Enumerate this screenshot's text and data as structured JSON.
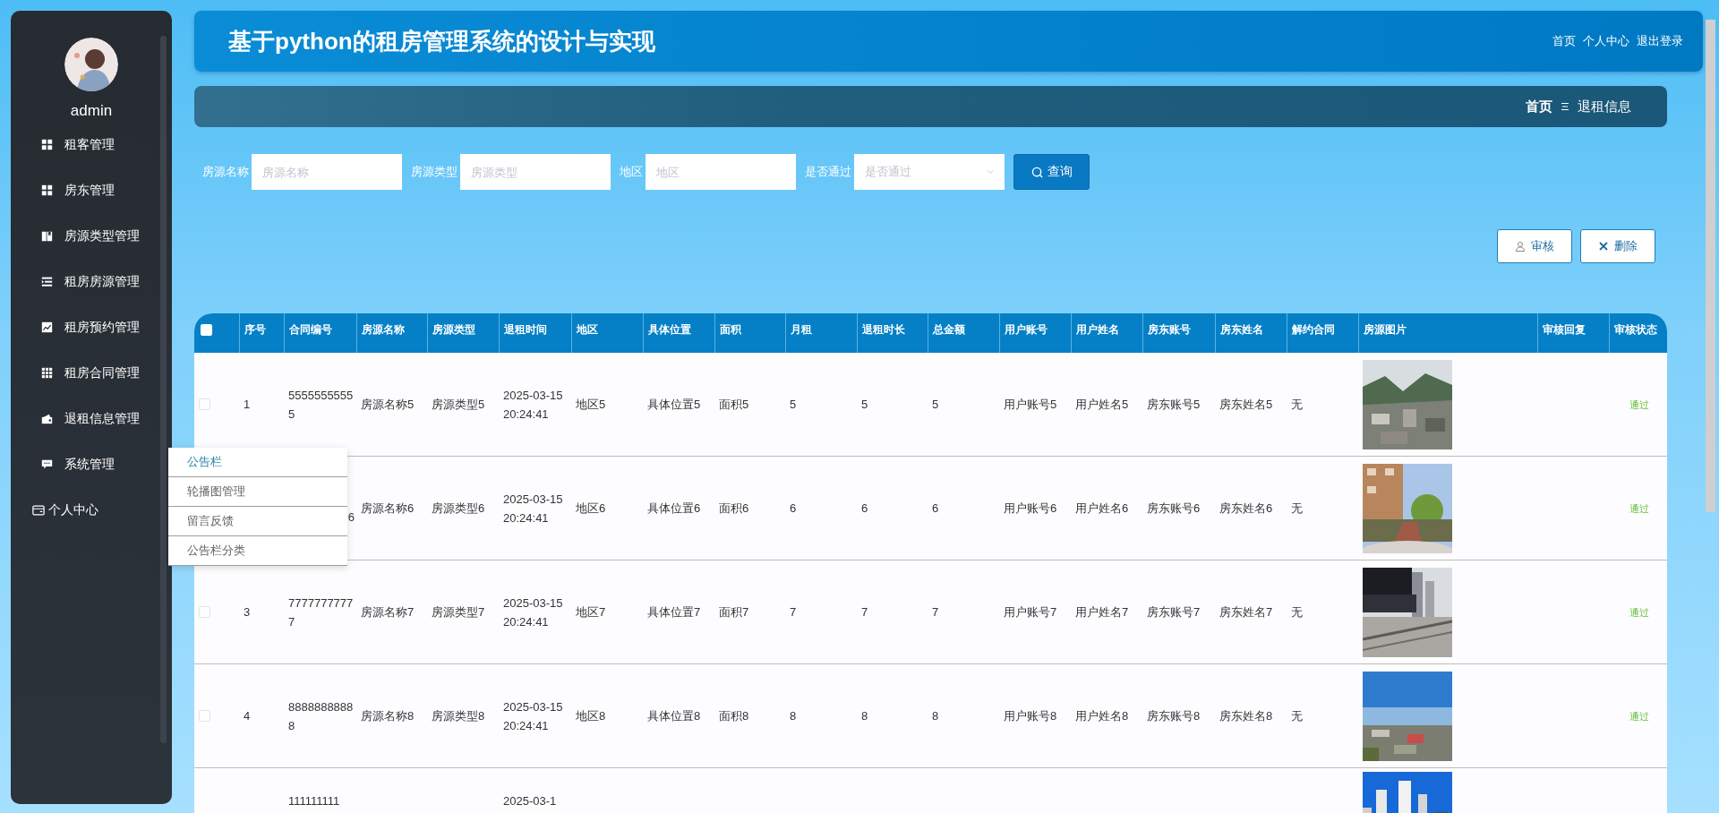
{
  "sidebar": {
    "user": "admin",
    "items": [
      {
        "label": "租客管理"
      },
      {
        "label": "房东管理"
      },
      {
        "label": "房源类型管理"
      },
      {
        "label": "租房房源管理"
      },
      {
        "label": "租房预约管理"
      },
      {
        "label": "租房合同管理"
      },
      {
        "label": "退租信息管理"
      },
      {
        "label": "系统管理"
      }
    ],
    "personal": "个人中心"
  },
  "system_menu": [
    {
      "label": "公告栏",
      "hovered": true
    },
    {
      "label": "轮播图管理",
      "hovered": false
    },
    {
      "label": "留言反馈",
      "hovered": false
    },
    {
      "label": "公告栏分类",
      "hovered": false
    }
  ],
  "header": {
    "title": "基于python的租房管理系统的设计与实现",
    "links": [
      "首页",
      "个人中心",
      "退出登录"
    ]
  },
  "breadcrumb": [
    "首页",
    "退租信息"
  ],
  "search": {
    "fields": [
      {
        "label": "房源名称",
        "placeholder": "房源名称",
        "kind": "input"
      },
      {
        "label": "房源类型",
        "placeholder": "房源类型",
        "kind": "input"
      },
      {
        "label": "地区",
        "placeholder": "地区",
        "kind": "input"
      },
      {
        "label": "是否通过",
        "placeholder": "是否通过",
        "kind": "select"
      }
    ],
    "button": "查询"
  },
  "actions": [
    "审核",
    "删除"
  ],
  "table": {
    "all_checked": false,
    "columns": [
      "序号",
      "合同编号",
      "房源名称",
      "房源类型",
      "退租时间",
      "地区",
      "具体位置",
      "面积",
      "月租",
      "退租时长",
      "总金额",
      "用户账号",
      "用户姓名",
      "房东账号",
      "房东姓名",
      "解约合同",
      "房源图片",
      "审核回复",
      "审核状态"
    ],
    "rows": [
      {
        "checked": false,
        "cells": [
          "1",
          "55555555555",
          "房源名称5",
          "房源类型5",
          "2025-03-15 20:24:41",
          "地区5",
          "具体位置5",
          "面积5",
          "5",
          "5",
          "5",
          "用户账号5",
          "用户姓名5",
          "房东账号5",
          "房东姓名5",
          "无"
        ],
        "status": "通过"
      },
      {
        "cells": [
          "",
          "6",
          "房源名称6",
          "房源类型6",
          "2025-03-15 20:24:41",
          "地区6",
          "具体位置6",
          "面积6",
          "6",
          "6",
          "6",
          "用户账号6",
          "用户姓名6",
          "房东账号6",
          "房东姓名6",
          "无"
        ],
        "status": "通过"
      },
      {
        "checked": false,
        "cells": [
          "3",
          "77777777777",
          "房源名称7",
          "房源类型7",
          "2025-03-15 20:24:41",
          "地区7",
          "具体位置7",
          "面积7",
          "7",
          "7",
          "7",
          "用户账号7",
          "用户姓名7",
          "房东账号7",
          "房东姓名7",
          "无"
        ],
        "status": "通过"
      },
      {
        "checked": false,
        "cells": [
          "4",
          "88888888888",
          "房源名称8",
          "房源类型8",
          "2025-03-15 20:24:41",
          "地区8",
          "具体位置8",
          "面积8",
          "8",
          "8",
          "8",
          "用户账号8",
          "用户姓名8",
          "房东账号8",
          "房东姓名8",
          "无"
        ],
        "status": "通过"
      },
      {
        "cells": [
          "",
          "111111111",
          "",
          "",
          "2025-03-1"
        ]
      }
    ]
  }
}
